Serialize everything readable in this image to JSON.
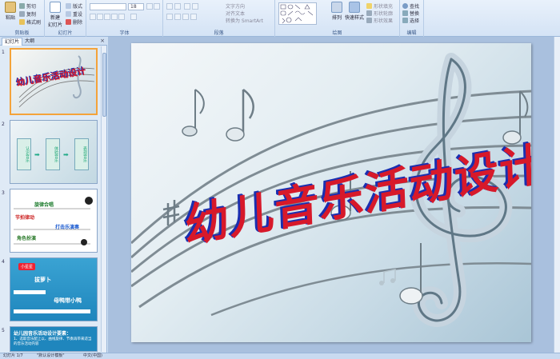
{
  "ribbon": {
    "groups": {
      "clipboard": "剪贴板",
      "slides": "幻灯片",
      "font": "字体",
      "paragraph": "段落",
      "drawing": "绘图",
      "editing": "编辑"
    },
    "paste": "粘贴",
    "cut": "剪切",
    "copy": "复制",
    "format_painter": "格式刷",
    "new_slide": "新建",
    "new_slide_sub": "幻灯片",
    "layout": "版式",
    "reset": "重设",
    "delete": "删除",
    "font_size": "18",
    "text_direction": "文字方向",
    "align_text": "对齐文本",
    "smartart": "转换为 SmartArt",
    "arrange": "排列",
    "quick_styles": "快速样式",
    "shape_fill": "形状填充",
    "shape_outline": "形状轮廓",
    "shape_effects": "形状效果",
    "find": "查找",
    "replace": "替换",
    "select": "选择"
  },
  "panel": {
    "tab_slides": "幻灯片",
    "tab_outline": "大纲",
    "close": "×",
    "thumbs": [
      {
        "num": "1",
        "title": "幼儿音乐活动设计"
      },
      {
        "num": "2",
        "labels": [
          "认识音乐",
          "体验音乐",
          "表现音乐"
        ]
      },
      {
        "num": "3",
        "labels": [
          "旋律合唱",
          "节拍律动",
          "打击乐演奏",
          "角色扮演"
        ]
      },
      {
        "num": "4",
        "labels": [
          "小星星",
          "拔萝卜",
          "母鸭带小鸭"
        ]
      },
      {
        "num": "5",
        "labels": [
          "幼儿园音乐活动设计要素：",
          "1、选取音乐配上以、曲线旋律、节奏再带来适当的音乐活动内容"
        ]
      }
    ]
  },
  "slide": {
    "title": "幼儿音乐活动设计"
  },
  "status": {
    "slide_info": "幻灯片 1/7",
    "theme": "\"默认设计模板\"",
    "language": "中文(中国)"
  },
  "colors": {
    "title_red": "#d7192a",
    "title_shadow": "#1a2fb0",
    "selection": "#f4a33a"
  }
}
